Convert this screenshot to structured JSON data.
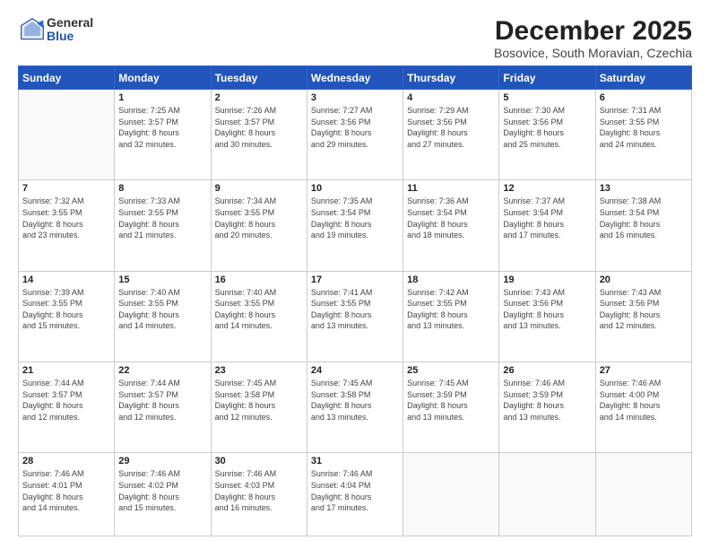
{
  "logo": {
    "general": "General",
    "blue": "Blue"
  },
  "title": "December 2025",
  "subtitle": "Bosovice, South Moravian, Czechia",
  "days_header": [
    "Sunday",
    "Monday",
    "Tuesday",
    "Wednesday",
    "Thursday",
    "Friday",
    "Saturday"
  ],
  "weeks": [
    [
      {
        "day": "",
        "info": ""
      },
      {
        "day": "1",
        "info": "Sunrise: 7:25 AM\nSunset: 3:57 PM\nDaylight: 8 hours\nand 32 minutes."
      },
      {
        "day": "2",
        "info": "Sunrise: 7:26 AM\nSunset: 3:57 PM\nDaylight: 8 hours\nand 30 minutes."
      },
      {
        "day": "3",
        "info": "Sunrise: 7:27 AM\nSunset: 3:56 PM\nDaylight: 8 hours\nand 29 minutes."
      },
      {
        "day": "4",
        "info": "Sunrise: 7:29 AM\nSunset: 3:56 PM\nDaylight: 8 hours\nand 27 minutes."
      },
      {
        "day": "5",
        "info": "Sunrise: 7:30 AM\nSunset: 3:56 PM\nDaylight: 8 hours\nand 25 minutes."
      },
      {
        "day": "6",
        "info": "Sunrise: 7:31 AM\nSunset: 3:55 PM\nDaylight: 8 hours\nand 24 minutes."
      }
    ],
    [
      {
        "day": "7",
        "info": "Sunrise: 7:32 AM\nSunset: 3:55 PM\nDaylight: 8 hours\nand 23 minutes."
      },
      {
        "day": "8",
        "info": "Sunrise: 7:33 AM\nSunset: 3:55 PM\nDaylight: 8 hours\nand 21 minutes."
      },
      {
        "day": "9",
        "info": "Sunrise: 7:34 AM\nSunset: 3:55 PM\nDaylight: 8 hours\nand 20 minutes."
      },
      {
        "day": "10",
        "info": "Sunrise: 7:35 AM\nSunset: 3:54 PM\nDaylight: 8 hours\nand 19 minutes."
      },
      {
        "day": "11",
        "info": "Sunrise: 7:36 AM\nSunset: 3:54 PM\nDaylight: 8 hours\nand 18 minutes."
      },
      {
        "day": "12",
        "info": "Sunrise: 7:37 AM\nSunset: 3:54 PM\nDaylight: 8 hours\nand 17 minutes."
      },
      {
        "day": "13",
        "info": "Sunrise: 7:38 AM\nSunset: 3:54 PM\nDaylight: 8 hours\nand 16 minutes."
      }
    ],
    [
      {
        "day": "14",
        "info": "Sunrise: 7:39 AM\nSunset: 3:55 PM\nDaylight: 8 hours\nand 15 minutes."
      },
      {
        "day": "15",
        "info": "Sunrise: 7:40 AM\nSunset: 3:55 PM\nDaylight: 8 hours\nand 14 minutes."
      },
      {
        "day": "16",
        "info": "Sunrise: 7:40 AM\nSunset: 3:55 PM\nDaylight: 8 hours\nand 14 minutes."
      },
      {
        "day": "17",
        "info": "Sunrise: 7:41 AM\nSunset: 3:55 PM\nDaylight: 8 hours\nand 13 minutes."
      },
      {
        "day": "18",
        "info": "Sunrise: 7:42 AM\nSunset: 3:55 PM\nDaylight: 8 hours\nand 13 minutes."
      },
      {
        "day": "19",
        "info": "Sunrise: 7:43 AM\nSunset: 3:56 PM\nDaylight: 8 hours\nand 13 minutes."
      },
      {
        "day": "20",
        "info": "Sunrise: 7:43 AM\nSunset: 3:56 PM\nDaylight: 8 hours\nand 12 minutes."
      }
    ],
    [
      {
        "day": "21",
        "info": "Sunrise: 7:44 AM\nSunset: 3:57 PM\nDaylight: 8 hours\nand 12 minutes."
      },
      {
        "day": "22",
        "info": "Sunrise: 7:44 AM\nSunset: 3:57 PM\nDaylight: 8 hours\nand 12 minutes."
      },
      {
        "day": "23",
        "info": "Sunrise: 7:45 AM\nSunset: 3:58 PM\nDaylight: 8 hours\nand 12 minutes."
      },
      {
        "day": "24",
        "info": "Sunrise: 7:45 AM\nSunset: 3:58 PM\nDaylight: 8 hours\nand 13 minutes."
      },
      {
        "day": "25",
        "info": "Sunrise: 7:45 AM\nSunset: 3:59 PM\nDaylight: 8 hours\nand 13 minutes."
      },
      {
        "day": "26",
        "info": "Sunrise: 7:46 AM\nSunset: 3:59 PM\nDaylight: 8 hours\nand 13 minutes."
      },
      {
        "day": "27",
        "info": "Sunrise: 7:46 AM\nSunset: 4:00 PM\nDaylight: 8 hours\nand 14 minutes."
      }
    ],
    [
      {
        "day": "28",
        "info": "Sunrise: 7:46 AM\nSunset: 4:01 PM\nDaylight: 8 hours\nand 14 minutes."
      },
      {
        "day": "29",
        "info": "Sunrise: 7:46 AM\nSunset: 4:02 PM\nDaylight: 8 hours\nand 15 minutes."
      },
      {
        "day": "30",
        "info": "Sunrise: 7:46 AM\nSunset: 4:03 PM\nDaylight: 8 hours\nand 16 minutes."
      },
      {
        "day": "31",
        "info": "Sunrise: 7:46 AM\nSunset: 4:04 PM\nDaylight: 8 hours\nand 17 minutes."
      },
      {
        "day": "",
        "info": ""
      },
      {
        "day": "",
        "info": ""
      },
      {
        "day": "",
        "info": ""
      }
    ]
  ]
}
